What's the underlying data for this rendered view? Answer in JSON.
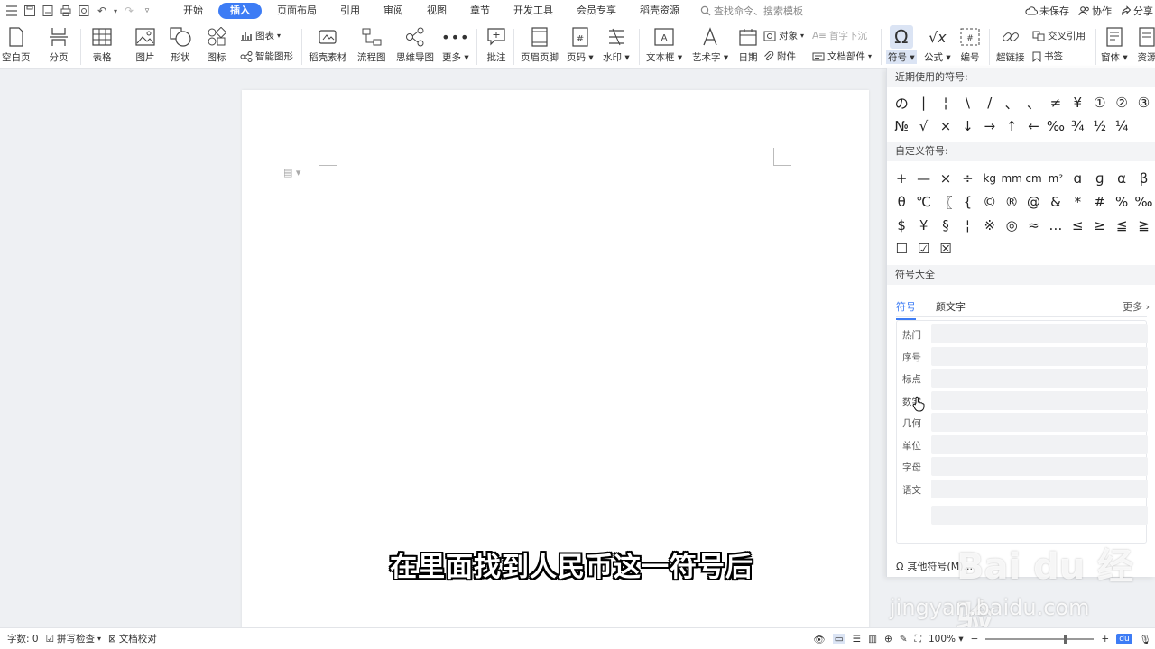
{
  "menubar": {
    "tabs": [
      "开始",
      "插入",
      "页面布局",
      "引用",
      "审阅",
      "视图",
      "章节",
      "开发工具",
      "会员专享",
      "稻壳资源"
    ],
    "active_tab": "插入",
    "search_placeholder": "查找命令、搜索模板",
    "unsaved": "未保存",
    "collab": "协作",
    "share": "分享"
  },
  "ribbon": {
    "blank_page": "空白页",
    "page_break": "分页",
    "table": "表格",
    "picture": "图片",
    "shape": "形状",
    "icon": "图标",
    "chart": "图表",
    "smart_shape": "智能图形",
    "docer_material": "稻壳素材",
    "flowchart": "流程图",
    "mindmap": "思维导图",
    "more": "更多",
    "comment": "批注",
    "header_footer": "页眉页脚",
    "page_number": "页码",
    "watermark": "水印",
    "textbox": "文本框",
    "wordart": "艺术字",
    "date": "日期",
    "object": "对象",
    "drop_cap": "首字下沉",
    "attachment": "附件",
    "doc_parts": "文档部件",
    "symbol": "符号",
    "formula": "公式",
    "numbering": "编号",
    "hyperlink": "超链接",
    "cross_ref": "交叉引用",
    "bookmark": "书签",
    "window": "窗体",
    "resources": "资源"
  },
  "panel": {
    "recent_title": "近期使用的符号:",
    "recent_symbols": [
      "の",
      "|",
      "¦",
      "\\",
      "/",
      "、",
      "、",
      "≠",
      "¥",
      "①",
      "②",
      "③",
      "№",
      "√",
      "×",
      "↓",
      "→",
      "↑",
      "←",
      "‰",
      "¾",
      "½",
      "¼"
    ],
    "custom_title": "自定义符号:",
    "custom_symbols": [
      "+",
      "—",
      "×",
      "÷",
      "kg",
      "mm",
      "cm",
      "m²",
      "ɑ",
      "ɡ",
      "α",
      "β",
      "θ",
      "℃",
      "〖",
      "{",
      "©",
      "®",
      "@",
      "&",
      "*",
      "#",
      "%",
      "‰",
      "$",
      "¥",
      "§",
      "¦",
      "※",
      "◎",
      "≈",
      "…",
      "≤",
      "≥",
      "≦",
      "≧",
      "☐",
      "☑",
      "☒"
    ],
    "all_title": "符号大全",
    "tab_symbol": "符号",
    "tab_kaomoji": "颜文字",
    "more": "更多",
    "categories": [
      "热门",
      "序号",
      "标点",
      "数学",
      "几何",
      "单位",
      "字母",
      "语文"
    ],
    "other_symbols": "其他符号(M)..."
  },
  "subtitle": "在里面找到人民币这一符号后",
  "watermark": {
    "brand": "Bai du 经验",
    "url": "jingyan.baidu.com"
  },
  "statusbar": {
    "word_count": "字数: 0",
    "spell_check": "拼写检查",
    "proofread": "文档校对",
    "zoom": "100%",
    "zoom_level": 0.75,
    "du_label": "du"
  }
}
